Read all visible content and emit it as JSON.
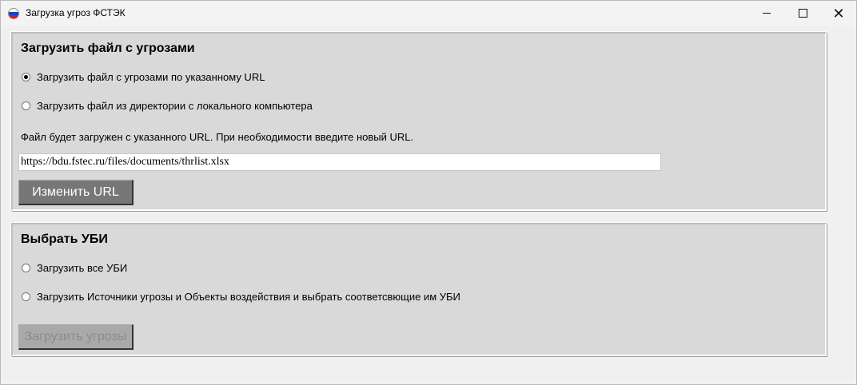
{
  "window": {
    "title": "Загрузка угроз ФСТЭК"
  },
  "load_file": {
    "heading": "Загрузить файл с угрозами",
    "options": [
      {
        "label": "Загрузить файл с угрозами по указанному URL",
        "checked": true
      },
      {
        "label": "Загрузить файл из директории с локального компьютера",
        "checked": false
      }
    ],
    "info": "Файл будет загружен с указанного URL. При необходимости введите новый URL.",
    "url_value": "https://bdu.fstec.ru/files/documents/thrlist.xlsx",
    "change_url_label": "Изменить URL"
  },
  "select_ubi": {
    "heading": "Выбрать УБИ",
    "options": [
      {
        "label": "Загрузить все УБИ",
        "checked": false
      },
      {
        "label": "Загрузить Источники угрозы и Объекты воздействия и выбрать соответсвющие им УБИ",
        "checked": false
      }
    ],
    "load_threats_label": "Загрузить угрозы"
  },
  "icons": {
    "app": "russian-flag-icon",
    "minimize": "minimize-icon",
    "maximize": "maximize-icon",
    "close": "close-icon"
  }
}
